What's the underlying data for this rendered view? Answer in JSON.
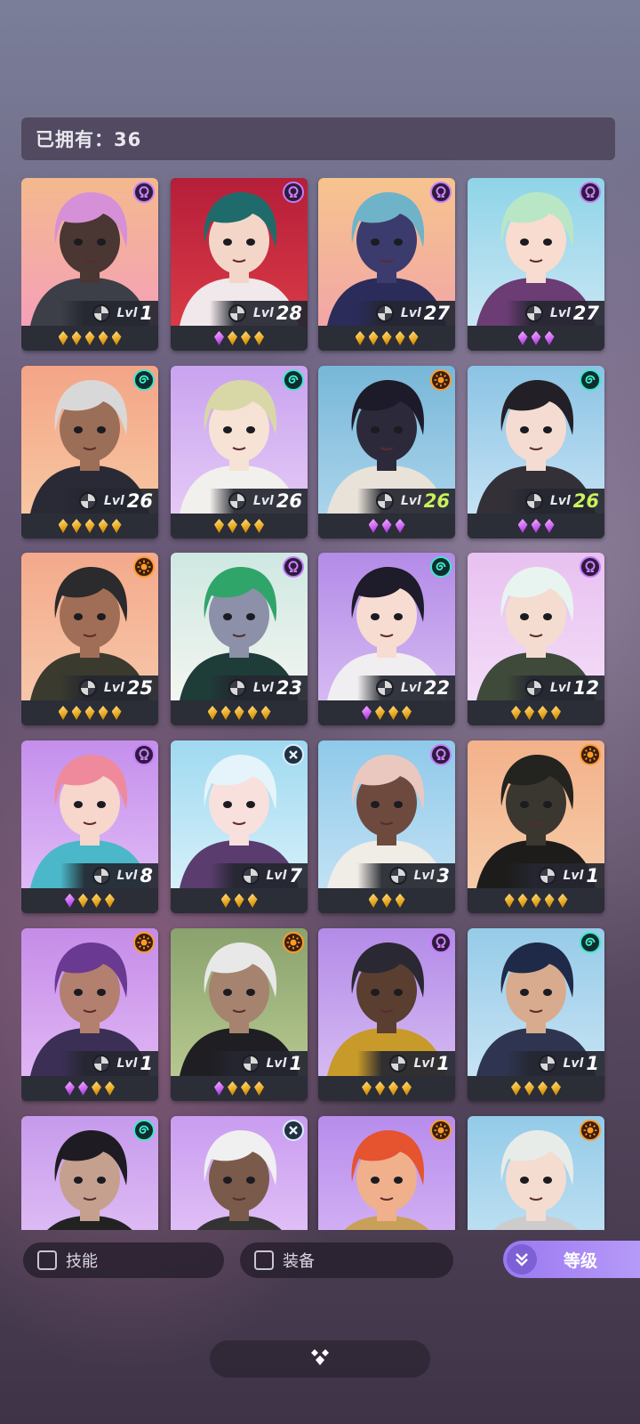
{
  "header": {
    "owned_text": "已拥有：36"
  },
  "colors": {
    "gold_gem": "#f0b429",
    "purple_gem": "#c85cf0",
    "level_highlight": "#c8f25a",
    "sort_button": "#a98af5"
  },
  "level_prefix": "Lvl",
  "heroes": [
    {
      "class_icon": "omega-icon",
      "level": "1",
      "gems": [
        "gold",
        "gold",
        "gold",
        "gold",
        "gold"
      ],
      "bg": [
        "#f4b98e",
        "#f5a0b8"
      ],
      "hair": "#d690d8",
      "skin": "#4a3632",
      "outfit": "#3c3f47"
    },
    {
      "class_icon": "omega-icon",
      "level": "28",
      "gems": [
        "purple",
        "gold",
        "gold",
        "gold"
      ],
      "bg": [
        "#b51e3a",
        "#d93a45"
      ],
      "hair": "#1f6b6c",
      "skin": "#f4d6c8",
      "outfit": "#f0e8ea"
    },
    {
      "class_icon": "omega-icon",
      "level": "27",
      "gems": [
        "gold",
        "gold",
        "gold",
        "gold",
        "gold"
      ],
      "bg": [
        "#f6c48e",
        "#f2a6a6"
      ],
      "hair": "#6fb3c8",
      "skin": "#3c3b6e",
      "outfit": "#2b2c5a"
    },
    {
      "class_icon": "omega-icon",
      "level": "27",
      "gems": [
        "purple",
        "purple",
        "purple"
      ],
      "bg": [
        "#8fd4e8",
        "#c8e6f4"
      ],
      "hair": "#b9e7c6",
      "skin": "#f7dccf",
      "outfit": "#6c3c74"
    },
    {
      "class_icon": "swirl-icon",
      "level": "26",
      "gems": [
        "gold",
        "gold",
        "gold",
        "gold",
        "gold"
      ],
      "bg": [
        "#f4a487",
        "#f7c7a1"
      ],
      "hair": "#d8d8d8",
      "skin": "#9b6e58",
      "outfit": "#2a2936"
    },
    {
      "class_icon": "swirl-icon",
      "level": "26",
      "gems": [
        "gold",
        "gold",
        "gold",
        "gold"
      ],
      "bg": [
        "#c9a3f0",
        "#e4c9f5"
      ],
      "hair": "#d8d8a6",
      "skin": "#f7e2d6",
      "outfit": "#f2f0ec"
    },
    {
      "class_icon": "sun-icon",
      "level": "26",
      "gems": [
        "purple",
        "purple",
        "purple"
      ],
      "bg": [
        "#78b7d8",
        "#aad4ec"
      ],
      "hair": "#1d1b2a",
      "skin": "#2c2a3a",
      "outfit": "#e8e2d8",
      "hl": true
    },
    {
      "class_icon": "swirl-icon",
      "level": "26",
      "gems": [
        "purple",
        "purple",
        "purple"
      ],
      "bg": [
        "#8bc3e4",
        "#c4e2f4"
      ],
      "hair": "#222026",
      "skin": "#f5dcd2",
      "outfit": "#333038",
      "hl": true
    },
    {
      "class_icon": "sun-icon",
      "level": "25",
      "gems": [
        "gold",
        "gold",
        "gold",
        "gold",
        "gold"
      ],
      "bg": [
        "#f4a98b",
        "#f7c7a9"
      ],
      "hair": "#2b2a2c",
      "skin": "#a06e56",
      "outfit": "#3a3a2e"
    },
    {
      "class_icon": "omega-icon",
      "level": "23",
      "gems": [
        "gold",
        "gold",
        "gold",
        "gold",
        "gold"
      ],
      "bg": [
        "#cfe8e2",
        "#f3f5f0"
      ],
      "hair": "#2fa56a",
      "skin": "#8c90a8",
      "outfit": "#1e3c38"
    },
    {
      "class_icon": "swirl-icon",
      "level": "22",
      "gems": [
        "purple",
        "gold",
        "gold",
        "gold"
      ],
      "bg": [
        "#b38be8",
        "#d5b9f2"
      ],
      "hair": "#1e1b2a",
      "skin": "#f7dcd2",
      "outfit": "#f0eef0"
    },
    {
      "class_icon": "omega-icon",
      "level": "12",
      "gems": [
        "gold",
        "gold",
        "gold",
        "gold"
      ],
      "bg": [
        "#e8c1f0",
        "#f4dcf8"
      ],
      "hair": "#e8f4f0",
      "skin": "#f4dcd0",
      "outfit": "#3f4a3a"
    },
    {
      "class_icon": "omega-icon",
      "level": "8",
      "gems": [
        "purple",
        "gold",
        "gold",
        "gold"
      ],
      "bg": [
        "#c48fec",
        "#e0b9f6"
      ],
      "hair": "#ef8a9c",
      "skin": "#f7d6cc",
      "outfit": "#4ab8c8"
    },
    {
      "class_icon": "cross-icon",
      "level": "7",
      "gems": [
        "gold",
        "gold",
        "gold"
      ],
      "bg": [
        "#9fd9f0",
        "#d6f0fa"
      ],
      "hair": "#e4f4fa",
      "skin": "#f8e0dc",
      "outfit": "#5a3d6e"
    },
    {
      "class_icon": "omega-icon",
      "level": "3",
      "gems": [
        "gold",
        "gold",
        "gold"
      ],
      "bg": [
        "#8fc9ea",
        "#c1e1f4"
      ],
      "hair": "#eac8c0",
      "skin": "#6e4a3e",
      "outfit": "#f0ece6"
    },
    {
      "class_icon": "sun-icon",
      "level": "1",
      "gems": [
        "gold",
        "gold",
        "gold",
        "gold",
        "gold"
      ],
      "bg": [
        "#f3b18a",
        "#f6cba8"
      ],
      "hair": "#23231f",
      "skin": "#3a3630",
      "outfit": "#1d1c1a"
    },
    {
      "class_icon": "sun-icon",
      "level": "1",
      "gems": [
        "purple",
        "purple",
        "gold",
        "gold"
      ],
      "bg": [
        "#c58ce8",
        "#e0b6f4"
      ],
      "hair": "#6a3a92",
      "skin": "#b37f6e",
      "outfit": "#3c2f55"
    },
    {
      "class_icon": "sun-icon",
      "level": "1",
      "gems": [
        "purple",
        "gold",
        "gold",
        "gold"
      ],
      "bg": [
        "#8aa26e",
        "#b6c88f"
      ],
      "hair": "#e8e8e8",
      "skin": "#a6836e",
      "outfit": "#1f1e22"
    },
    {
      "class_icon": "omega-icon",
      "level": "1",
      "gems": [
        "gold",
        "gold",
        "gold",
        "gold"
      ],
      "bg": [
        "#b38be8",
        "#d5b9f2"
      ],
      "hair": "#2a2832",
      "skin": "#5a3e30",
      "outfit": "#c79a2a"
    },
    {
      "class_icon": "swirl-icon",
      "level": "1",
      "gems": [
        "gold",
        "gold",
        "gold",
        "gold"
      ],
      "bg": [
        "#96cbe8",
        "#c6e3f4"
      ],
      "hair": "#1e2a48",
      "skin": "#d8ab8e",
      "outfit": "#2f3550"
    },
    {
      "class_icon": "swirl-icon",
      "level": "",
      "gems": [],
      "bg": [
        "#c69aec",
        "#e4c4f6"
      ],
      "hair": "#1e1c22",
      "skin": "#c6a08e",
      "outfit": "#222"
    },
    {
      "class_icon": "cross-icon",
      "level": "",
      "gems": [],
      "bg": [
        "#c99cf0",
        "#e6c8f8"
      ],
      "hair": "#f0f0f0",
      "skin": "#7a5a4a",
      "outfit": "#333"
    },
    {
      "class_icon": "sun-icon",
      "level": "",
      "gems": [],
      "bg": [
        "#b78cec",
        "#d8b8f5"
      ],
      "hair": "#e5532f",
      "skin": "#f0b08c",
      "outfit": "#c8a05a"
    },
    {
      "class_icon": "sun-icon",
      "level": "",
      "gems": [],
      "bg": [
        "#93cbe8",
        "#c7e4f4"
      ],
      "hair": "#e8ece8",
      "skin": "#f4dcd0",
      "outfit": "#ccc"
    }
  ],
  "filters": {
    "skill_label": "技能",
    "equipment_label": "装备"
  },
  "sort": {
    "label": "等级",
    "icon": "double-chevron-down-icon"
  },
  "collapse": {
    "icon": "diamond-cluster-icon"
  }
}
